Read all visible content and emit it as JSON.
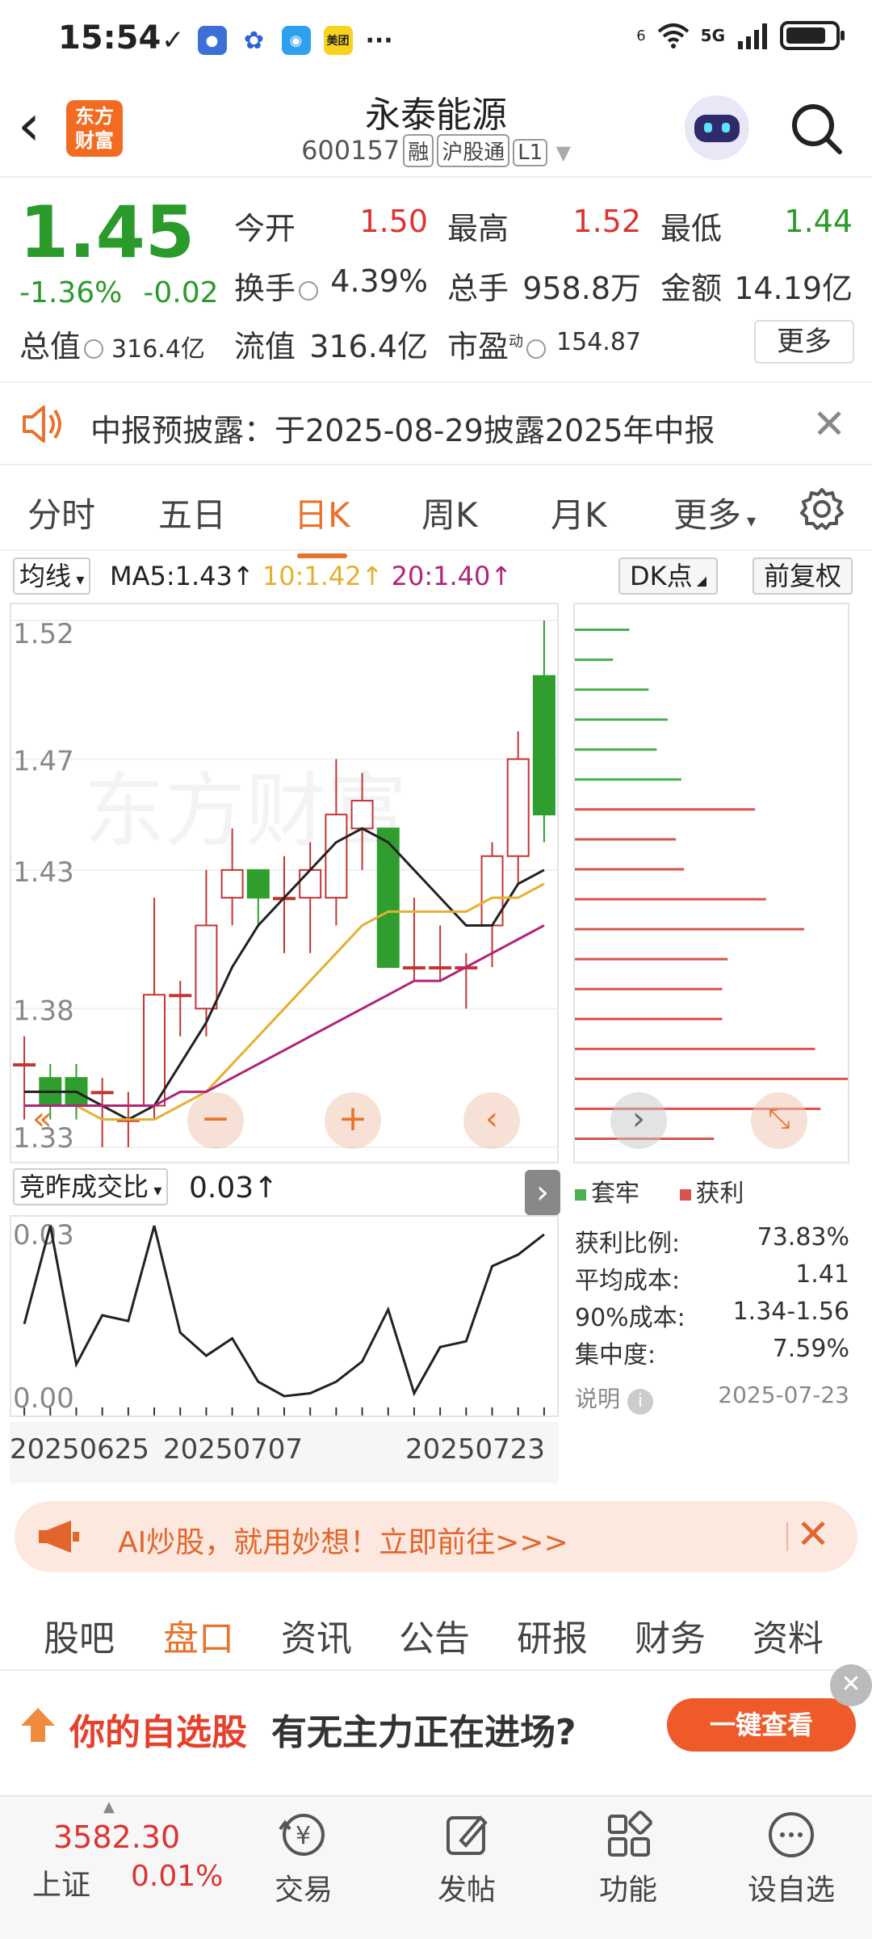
{
  "status": {
    "time": "15:54",
    "network": "5G",
    "app_icons": [
      "cloud-icon",
      "paw-icon",
      "camera-icon",
      "meituan-icon"
    ],
    "meituan": "美团",
    "more": "···",
    "signal": "6"
  },
  "header": {
    "logo_line1": "东方",
    "logo_line2": "财富",
    "title": "永泰能源",
    "code": "600157",
    "tag1": "融",
    "tag2": "沪股通",
    "tag3": "L1"
  },
  "quote": {
    "price": "1.45",
    "change_pct": "-1.36%",
    "change": "-0.02",
    "open_label": "今开",
    "open": "1.50",
    "high_label": "最高",
    "high": "1.52",
    "low_label": "最低",
    "low": "1.44",
    "turnover_label": "换手",
    "turnover": "4.39%",
    "vol_label": "总手",
    "vol": "958.8万",
    "amount_label": "金额",
    "amount": "14.19亿",
    "mktcap_label": "总值",
    "mktcap": "316.4亿",
    "float_label": "流值",
    "float": "316.4亿",
    "pe_label": "市盈",
    "pe_sup": "动",
    "pe": "154.87",
    "more": "更多"
  },
  "notice": {
    "text": "中报预披露：于2025-08-29披露2025年中报"
  },
  "tabs": [
    "分时",
    "五日",
    "日K",
    "周K",
    "月K",
    "更多"
  ],
  "active_tab": "日K",
  "chart_bar": {
    "ma_select": "均线",
    "ma5": "MA5:1.43",
    "ma10": "10:1.42",
    "ma20": "20:1.40",
    "dk": "DK点",
    "fq": "前复权"
  },
  "chart_data": {
    "type": "candlestick",
    "y_ticks": [
      "1.52",
      "1.47",
      "1.43",
      "1.38",
      "1.33"
    ],
    "ylim": [
      1.33,
      1.52
    ],
    "candles": [
      {
        "o": 1.36,
        "h": 1.37,
        "l": 1.34,
        "c": 1.36
      },
      {
        "o": 1.355,
        "h": 1.36,
        "l": 1.34,
        "c": 1.345
      },
      {
        "o": 1.355,
        "h": 1.36,
        "l": 1.34,
        "c": 1.345
      },
      {
        "o": 1.35,
        "h": 1.355,
        "l": 1.33,
        "c": 1.35
      },
      {
        "o": 1.34,
        "h": 1.35,
        "l": 1.33,
        "c": 1.34
      },
      {
        "o": 1.345,
        "h": 1.42,
        "l": 1.34,
        "c": 1.385
      },
      {
        "o": 1.385,
        "h": 1.39,
        "l": 1.37,
        "c": 1.385
      },
      {
        "o": 1.38,
        "h": 1.43,
        "l": 1.37,
        "c": 1.41
      },
      {
        "o": 1.42,
        "h": 1.445,
        "l": 1.41,
        "c": 1.43
      },
      {
        "o": 1.43,
        "h": 1.43,
        "l": 1.41,
        "c": 1.42
      },
      {
        "o": 1.42,
        "h": 1.435,
        "l": 1.4,
        "c": 1.42
      },
      {
        "o": 1.42,
        "h": 1.44,
        "l": 1.4,
        "c": 1.43
      },
      {
        "o": 1.42,
        "h": 1.47,
        "l": 1.41,
        "c": 1.45
      },
      {
        "o": 1.445,
        "h": 1.465,
        "l": 1.43,
        "c": 1.455
      },
      {
        "o": 1.445,
        "h": 1.445,
        "l": 1.395,
        "c": 1.395
      },
      {
        "o": 1.395,
        "h": 1.42,
        "l": 1.39,
        "c": 1.395
      },
      {
        "o": 1.395,
        "h": 1.41,
        "l": 1.39,
        "c": 1.395
      },
      {
        "o": 1.395,
        "h": 1.4,
        "l": 1.38,
        "c": 1.395
      },
      {
        "o": 1.41,
        "h": 1.44,
        "l": 1.395,
        "c": 1.435
      },
      {
        "o": 1.435,
        "h": 1.48,
        "l": 1.425,
        "c": 1.47
      },
      {
        "o": 1.5,
        "h": 1.52,
        "l": 1.44,
        "c": 1.45
      }
    ],
    "ma5": [
      1.35,
      1.35,
      1.35,
      1.345,
      1.34,
      1.345,
      1.36,
      1.375,
      1.395,
      1.41,
      1.42,
      1.43,
      1.44,
      1.445,
      1.44,
      1.43,
      1.42,
      1.41,
      1.41,
      1.425,
      1.43
    ],
    "ma10": [
      1.345,
      1.345,
      1.345,
      1.34,
      1.34,
      1.34,
      1.345,
      1.35,
      1.36,
      1.37,
      1.38,
      1.39,
      1.4,
      1.41,
      1.415,
      1.415,
      1.415,
      1.415,
      1.42,
      1.42,
      1.425
    ],
    "ma20": [
      1.345,
      1.345,
      1.345,
      1.345,
      1.345,
      1.345,
      1.35,
      1.35,
      1.355,
      1.36,
      1.365,
      1.37,
      1.375,
      1.38,
      1.385,
      1.39,
      1.39,
      1.395,
      1.4,
      1.405,
      1.41
    ],
    "colors": {
      "up": "#c23531",
      "down": "#2f9e2f",
      "ma5": "#222222",
      "ma10": "#e5b030",
      "ma20": "#b0247a"
    }
  },
  "vol_bar": {
    "select": "竞昨成交比",
    "value": "0.03"
  },
  "vol_chart": {
    "type": "line",
    "y_ticks": [
      "0.03",
      "0.00"
    ],
    "ylim": [
      0.0,
      0.033
    ],
    "values": [
      0.015,
      0.032,
      0.008,
      0.0165,
      0.0155,
      0.032,
      0.0135,
      0.0095,
      0.0125,
      0.005,
      0.0025,
      0.003,
      0.005,
      0.0085,
      0.0175,
      0.003,
      0.011,
      0.012,
      0.025,
      0.027,
      0.0305
    ]
  },
  "dates": [
    "20250625",
    "20250707",
    "20250723"
  ],
  "profile": {
    "bars": [
      {
        "w": 0.2,
        "c": "g"
      },
      {
        "w": 0.14,
        "c": "g"
      },
      {
        "w": 0.27,
        "c": "g"
      },
      {
        "w": 0.34,
        "c": "g"
      },
      {
        "w": 0.3,
        "c": "g"
      },
      {
        "w": 0.39,
        "c": "g"
      },
      {
        "w": 0.66,
        "c": "r"
      },
      {
        "w": 0.37,
        "c": "r"
      },
      {
        "w": 0.4,
        "c": "r"
      },
      {
        "w": 0.7,
        "c": "r"
      },
      {
        "w": 0.84,
        "c": "r"
      },
      {
        "w": 0.56,
        "c": "r"
      },
      {
        "w": 0.54,
        "c": "r"
      },
      {
        "w": 0.54,
        "c": "r"
      },
      {
        "w": 0.88,
        "c": "r"
      },
      {
        "w": 1.0,
        "c": "r"
      },
      {
        "w": 0.9,
        "c": "r"
      },
      {
        "w": 0.51,
        "c": "r"
      }
    ],
    "legend_trap": "套牢",
    "legend_profit": "获利",
    "profit_ratio_label": "获利比例:",
    "profit_ratio": "73.83%",
    "avg_cost_label": "平均成本:",
    "avg_cost": "1.41",
    "cost90_label": "90%成本:",
    "cost90": "1.34-1.56",
    "conc_label": "集中度:",
    "conc": "7.59%",
    "explain": "说明",
    "date": "2025-07-23"
  },
  "ai_banner": {
    "text": "AI炒股，就用妙想！立即前往>>>"
  },
  "bottom_tabs": [
    "股吧",
    "盘口",
    "资讯",
    "公告",
    "研报",
    "财务",
    "资料"
  ],
  "bottom_active": "盘口",
  "promo": {
    "t1": "你的自选股",
    "t2": "有无主力正在进场?",
    "btn": "一键查看"
  },
  "index": {
    "price": "3582.30",
    "name": "上证",
    "change": "0.01%"
  },
  "nav": [
    "交易",
    "发帖",
    "功能",
    "设自选"
  ],
  "watermark": "东方财富"
}
